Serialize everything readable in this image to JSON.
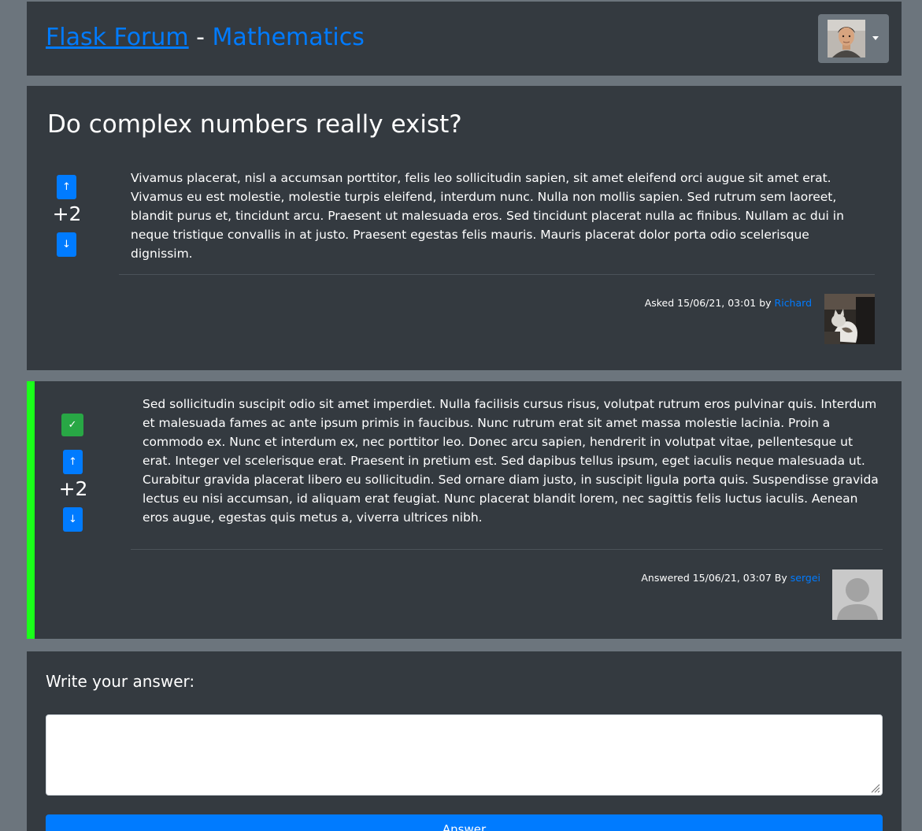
{
  "header": {
    "brand_link": "Flask Forum",
    "separator": " - ",
    "subforum": "Mathematics",
    "user_menu_icon": "caret-down-icon"
  },
  "question": {
    "title": "Do complex numbers really exist?",
    "upvote_glyph": "↑",
    "downvote_glyph": "↓",
    "score": "+2",
    "body": "Vivamus placerat, nisl a accumsan porttitor, felis leo sollicitudin sapien, sit amet eleifend orci augue sit amet erat. Vivamus eu est molestie, molestie turpis eleifend, interdum nunc. Nulla non mollis sapien. Sed rutrum sem laoreet, blandit purus et, tincidunt arcu. Praesent ut malesuada eros. Sed tincidunt placerat nulla ac finibus. Nullam ac dui in neque tristique convallis in at justo. Praesent egestas felis mauris. Mauris placerat dolor porta odio scelerisque dignissim.",
    "meta_prefix": "Asked 15/06/21, 03:01 by ",
    "author": "Richard"
  },
  "answer": {
    "accepted_glyph": "✓",
    "upvote_glyph": "↑",
    "downvote_glyph": "↓",
    "score": "+2",
    "body": "Sed sollicitudin suscipit odio sit amet imperdiet. Nulla facilisis cursus risus, volutpat rutrum eros pulvinar quis. Interdum et malesuada fames ac ante ipsum primis in faucibus. Nunc rutrum erat sit amet massa molestie lacinia. Proin a commodo ex. Nunc et interdum ex, nec porttitor leo. Donec arcu sapien, hendrerit in volutpat vitae, pellentesque ut erat. Integer vel scelerisque erat. Praesent in pretium est. Sed dapibus tellus ipsum, eget iaculis neque malesuada ut. Curabitur gravida placerat libero eu sollicitudin. Sed ornare diam justo, in suscipit ligula porta quis. Suspendisse gravida lectus eu nisi accumsan, id aliquam erat feugiat. Nunc placerat blandit lorem, nec sagittis felis luctus iaculis. Aenean eros augue, egestas quis metus a, viverra ultrices nibh.",
    "meta_prefix": "Answered 15/06/21, 03:07 By ",
    "author": "sergei"
  },
  "form": {
    "label": "Write your answer:",
    "textarea_value": "",
    "submit_label": "Answer"
  },
  "colors": {
    "page_bg": "#6c757d",
    "card_bg": "#343a40",
    "primary": "#007bff",
    "accepted_border": "#1aff1a",
    "accepted_badge": "#28a745"
  }
}
